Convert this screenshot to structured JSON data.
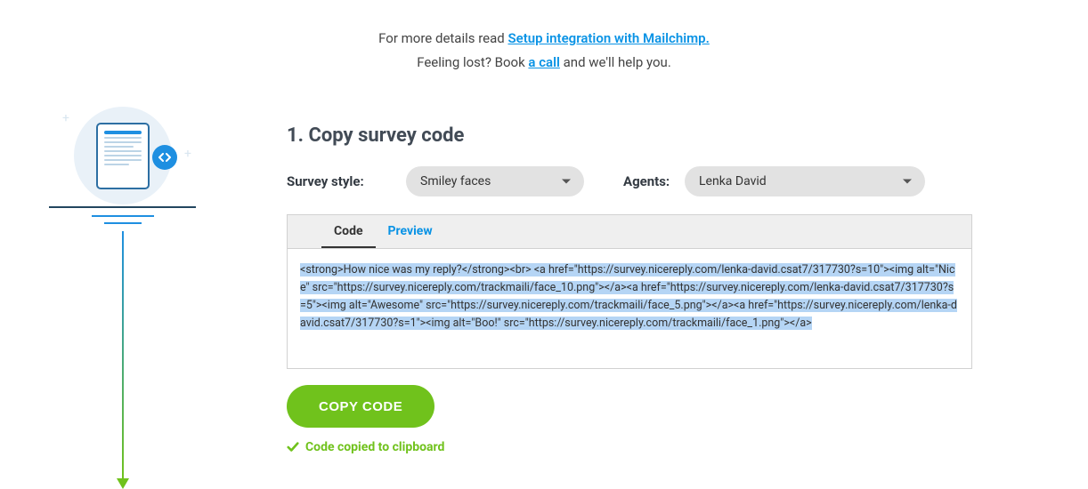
{
  "header": {
    "prefix": "For more details read ",
    "link1": "Setup integration with Mailchimp.",
    "line2_prefix": "Feeling lost? Book ",
    "link2": "a call",
    "line2_suffix": " and we'll help you."
  },
  "section": {
    "title": "1. Copy survey code"
  },
  "controls": {
    "style_label": "Survey style:",
    "style_value": "Smiley faces",
    "agents_label": "Agents:",
    "agents_value": "Lenka David"
  },
  "tabs": {
    "code": "Code",
    "preview": "Preview"
  },
  "code_snippet": "<strong>How nice was my reply?</strong><br>\n<a href=\"https://survey.nicereply.com/lenka-david.csat7/317730?s=10\"><img alt=\"Nice\" src=\"https://survey.nicereply.com/trackmaili/face_10.png\"></a><a href=\"https://survey.nicereply.com/lenka-david.csat7/317730?s=5\"><img alt=\"Awesome\" src=\"https://survey.nicereply.com/trackmaili/face_5.png\"></a><a href=\"https://survey.nicereply.com/lenka-david.csat7/317730?s=1\"><img alt=\"Boo!\" src=\"https://survey.nicereply.com/trackmaili/face_1.png\"></a>",
  "copy": {
    "button": "COPY CODE",
    "confirmation": "Code copied to clipboard"
  },
  "icons": {
    "code_badge": "‹ ›"
  }
}
